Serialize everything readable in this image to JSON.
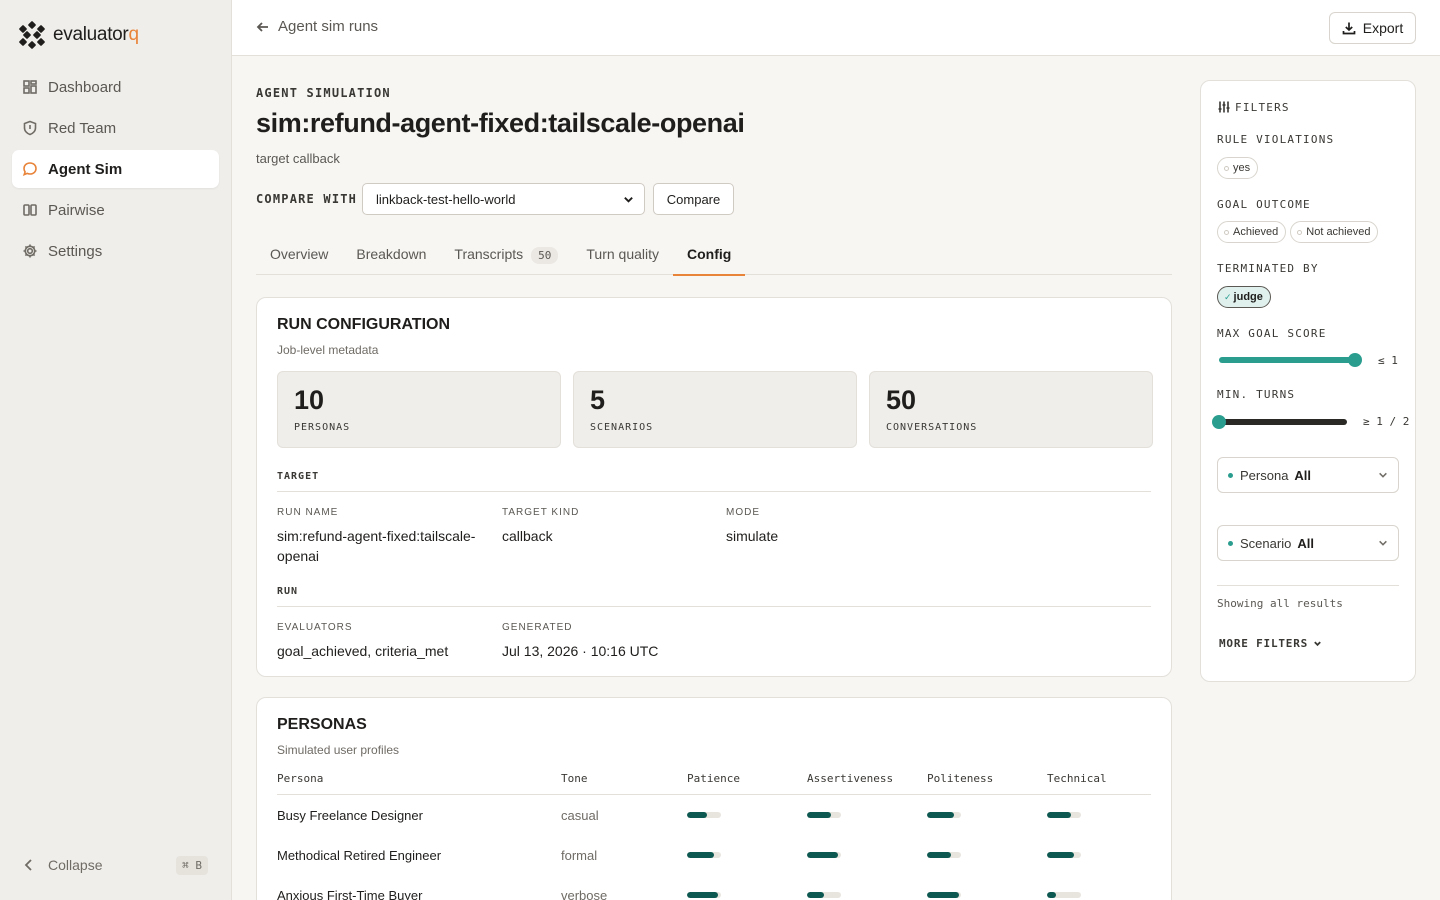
{
  "app": {
    "logo_main": "evaluator",
    "logo_accent": "q"
  },
  "sidebar": {
    "items": [
      {
        "label": "Dashboard",
        "icon": "dashboard-icon"
      },
      {
        "label": "Red Team",
        "icon": "shield-icon"
      },
      {
        "label": "Agent Sim",
        "icon": "chat-bubble-icon",
        "active": true
      },
      {
        "label": "Pairwise",
        "icon": "columns-icon"
      },
      {
        "label": "Settings",
        "icon": "gear-icon"
      }
    ],
    "collapse_label": "Collapse",
    "collapse_shortcut": "⌘ B"
  },
  "topbar": {
    "back_label": "Agent sim runs",
    "export_label": "Export"
  },
  "header": {
    "eyebrow": "AGENT SIMULATION",
    "title": "sim:refund-agent-fixed:tailscale-openai",
    "subtitle": "target callback",
    "compare_label": "COMPARE WITH",
    "compare_value": "linkback-test-hello-world",
    "compare_button": "Compare"
  },
  "tabs": [
    {
      "label": "Overview"
    },
    {
      "label": "Breakdown"
    },
    {
      "label": "Transcripts",
      "count": "50"
    },
    {
      "label": "Turn quality"
    },
    {
      "label": "Config",
      "active": true
    }
  ],
  "run_config": {
    "title": "RUN CONFIGURATION",
    "subtitle": "Job-level metadata",
    "stats": [
      {
        "value": "10",
        "label": "PERSONAS"
      },
      {
        "value": "5",
        "label": "SCENARIOS"
      },
      {
        "value": "50",
        "label": "CONVERSATIONS"
      }
    ],
    "target_heading": "TARGET",
    "target": [
      {
        "key": "RUN NAME",
        "value": "sim:refund-agent-fixed:tailscale-openai"
      },
      {
        "key": "TARGET KIND",
        "value": "callback"
      },
      {
        "key": "MODE",
        "value": "simulate"
      }
    ],
    "run_heading": "RUN",
    "run": [
      {
        "key": "EVALUATORS",
        "value": "goal_achieved, criteria_met"
      },
      {
        "key": "GENERATED",
        "value": "Jul 13, 2026 · 10:16 UTC"
      }
    ]
  },
  "personas": {
    "title": "PERSONAS",
    "subtitle": "Simulated user profiles",
    "columns": [
      "Persona",
      "Tone",
      "Patience",
      "Assertiveness",
      "Politeness",
      "Technical"
    ],
    "rows": [
      {
        "name": "Busy Freelance Designer",
        "tone": "casual",
        "patience": 0.6,
        "assertiveness": 0.7,
        "politeness": 0.8,
        "technical": 0.7
      },
      {
        "name": "Methodical Retired Engineer",
        "tone": "formal",
        "patience": 0.8,
        "assertiveness": 0.9,
        "politeness": 0.7,
        "technical": 0.8
      },
      {
        "name": "Anxious First-Time Buyer",
        "tone": "verbose",
        "patience": 0.9,
        "assertiveness": 0.5,
        "politeness": 0.95,
        "technical": 0.25
      }
    ]
  },
  "filters": {
    "title": "FILTERS",
    "rule_violations_label": "RULE VIOLATIONS",
    "rule_violations_options": [
      "yes"
    ],
    "goal_outcome_label": "GOAL OUTCOME",
    "goal_outcome_options": [
      "Achieved",
      "Not achieved"
    ],
    "terminated_by_label": "TERMINATED BY",
    "terminated_by_selected": "judge",
    "max_goal_score_label": "MAX GOAL SCORE",
    "max_goal_score_value": "≤ 1",
    "max_goal_score_level": 1.0,
    "min_turns_label": "MIN. TURNS",
    "min_turns_value": "≥ 1 / 2",
    "min_turns_level": 0.0,
    "persona_label": "Persona",
    "persona_value": "All",
    "scenario_label": "Scenario",
    "scenario_value": "All",
    "showing": "Showing all results",
    "more_filters": "MORE FILTERS"
  },
  "colors": {
    "accent": "#e8843a",
    "teal": "#2a9d8f",
    "meter": "#0e5852"
  }
}
